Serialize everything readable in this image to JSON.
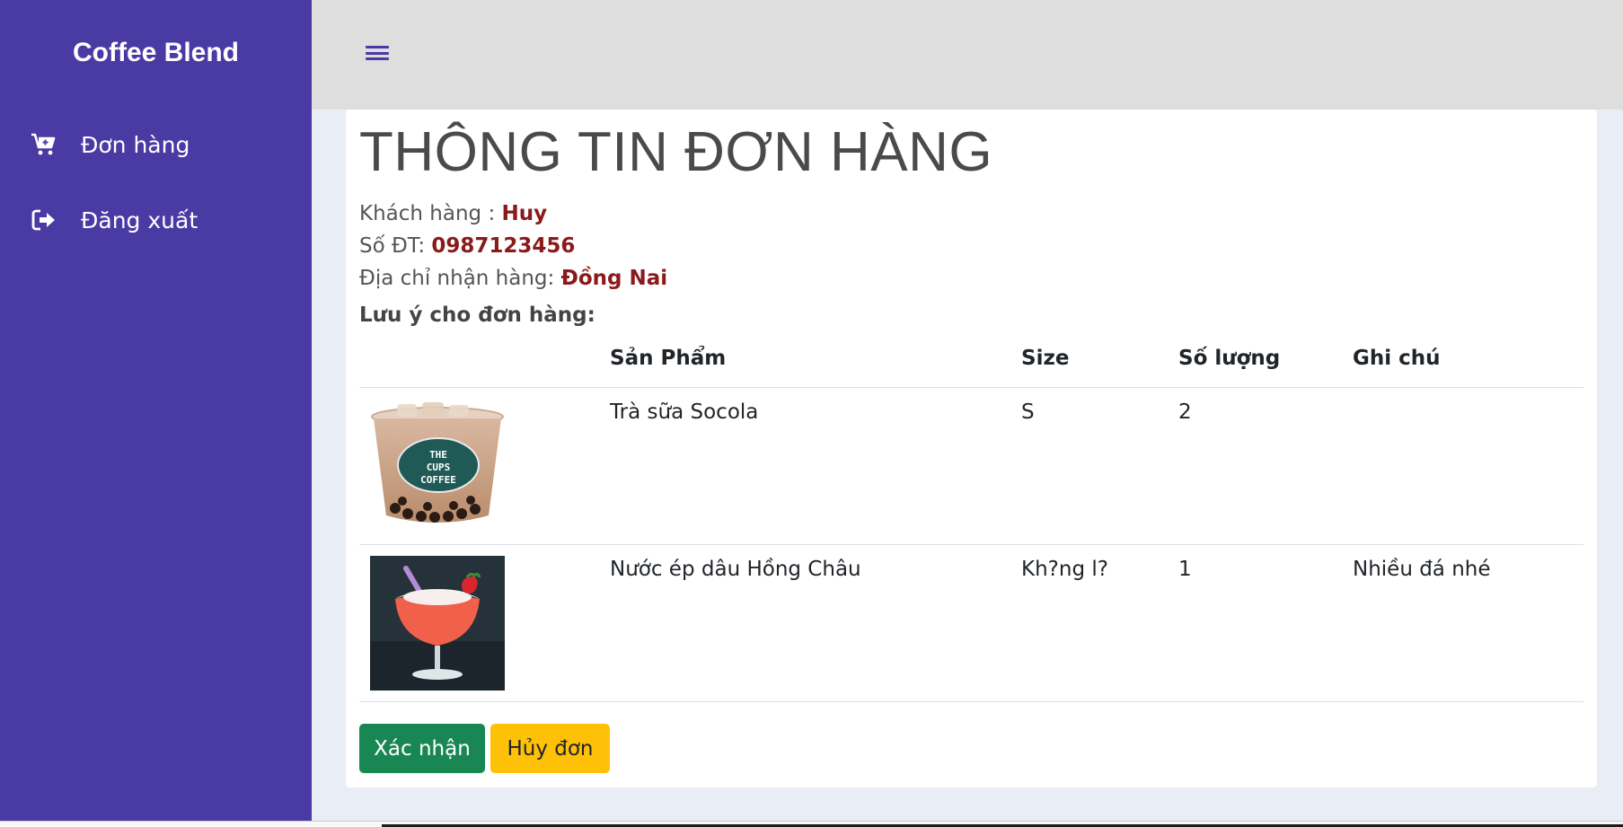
{
  "sidebar": {
    "brand": "Coffee Blend",
    "items": [
      {
        "label": "Đơn hàng",
        "icon": "cart-plus-icon"
      },
      {
        "label": "Đăng xuất",
        "icon": "sign-out-icon"
      }
    ]
  },
  "topbar": {
    "menu_icon": "hamburger-icon"
  },
  "order": {
    "title": "THÔNG TIN ĐƠN HÀNG",
    "customer_label": "Khách hàng : ",
    "customer_value": "Huy",
    "phone_label": "Số ĐT: ",
    "phone_value": "0987123456",
    "address_label": "Địa chỉ nhận hàng: ",
    "address_value": "Đồng Nai",
    "note_label": "Lưu ý cho đơn hàng:"
  },
  "table": {
    "headers": [
      "",
      "Sản Phẩm",
      "Size",
      "Số lượng",
      "Ghi chú"
    ],
    "rows": [
      {
        "product": "Trà sữa Socola",
        "size": "S",
        "qty": "2",
        "note": "",
        "image": "bubble-tea-cup",
        "cup_text": [
          "THE",
          "CUPS",
          "COFFEE"
        ]
      },
      {
        "product": "Nước ép dâu Hồng Châu",
        "size": "Kh?ng l?",
        "qty": "1",
        "note": "Nhiều đá nhé",
        "image": "strawberry-juice-glass"
      }
    ]
  },
  "buttons": {
    "confirm": "Xác nhận",
    "cancel": "Hủy đơn"
  },
  "colors": {
    "sidebar": "#4a3aa3",
    "topbar": "#dedede",
    "accent_value": "#8b1a1a",
    "confirm": "#198754",
    "cancel": "#ffc107"
  }
}
